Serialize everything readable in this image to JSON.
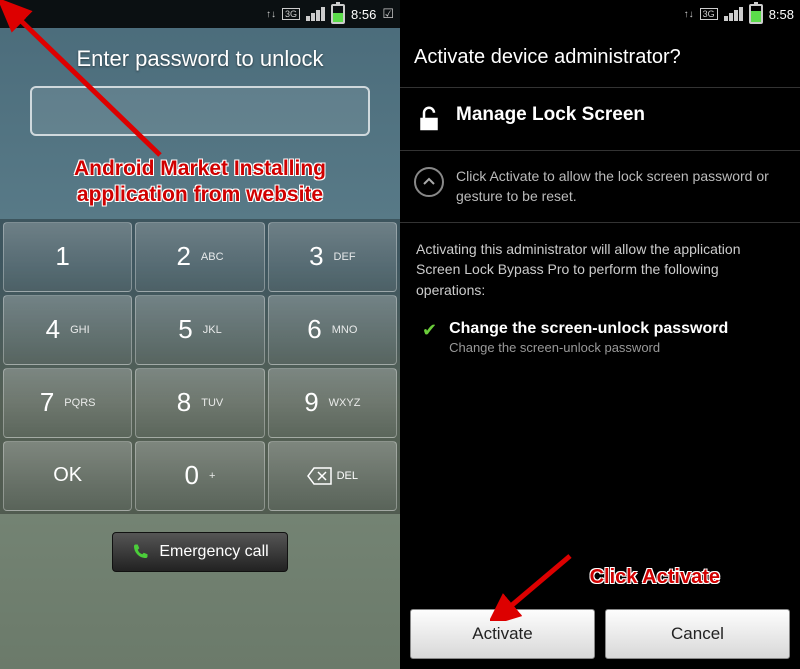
{
  "left": {
    "status": {
      "time": "8:56",
      "net": "3G"
    },
    "prompt": "Enter password to unlock",
    "annotation_line1": "Android Market Installing",
    "annotation_line2": "application from website",
    "keys": [
      {
        "d": "1",
        "s": ""
      },
      {
        "d": "2",
        "s": "ABC"
      },
      {
        "d": "3",
        "s": "DEF"
      },
      {
        "d": "4",
        "s": "GHI"
      },
      {
        "d": "5",
        "s": "JKL"
      },
      {
        "d": "6",
        "s": "MNO"
      },
      {
        "d": "7",
        "s": "PQRS"
      },
      {
        "d": "8",
        "s": "TUV"
      },
      {
        "d": "9",
        "s": "WXYZ"
      },
      {
        "d": "OK",
        "s": ""
      },
      {
        "d": "0",
        "s": "+"
      },
      {
        "d": "DEL",
        "s": ""
      }
    ],
    "emergency": "Emergency call"
  },
  "right": {
    "status": {
      "time": "8:58",
      "net": "3G"
    },
    "title": "Activate device administrator?",
    "section": "Manage Lock Screen",
    "hint": "Click Activate to allow the lock screen password or gesture to be reset.",
    "body": "Activating this administrator will allow the application Screen Lock Bypass Pro to perform the following operations:",
    "perm_title": "Change the screen-unlock password",
    "perm_sub": "Change the screen-unlock password",
    "annotation": "Click Activate",
    "activate": "Activate",
    "cancel": "Cancel"
  }
}
